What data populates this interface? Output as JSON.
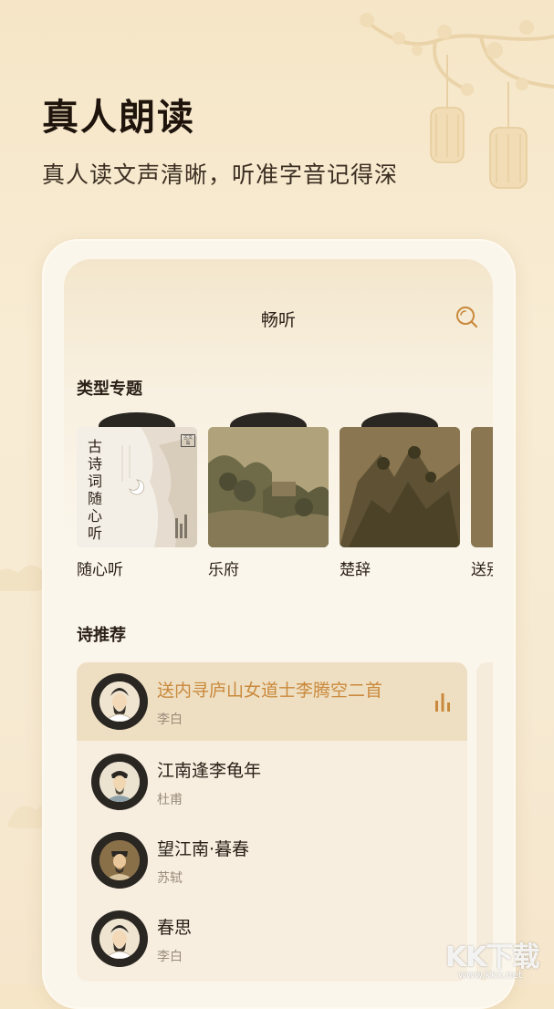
{
  "promo": {
    "headline": "真人朗读",
    "subline": "真人读文声清晰，听准字音记得深"
  },
  "app": {
    "title": "畅听",
    "search_icon": "search-icon"
  },
  "topics": {
    "title": "类型专题",
    "items": [
      {
        "label": "随心听",
        "cover_text": "古诗词随心听",
        "cover_badge": "古文岛"
      },
      {
        "label": "乐府"
      },
      {
        "label": "楚辞"
      },
      {
        "label": "送别"
      }
    ]
  },
  "recommend": {
    "title": "诗推荐",
    "items": [
      {
        "title": "送内寻庐山女道士李腾空二首",
        "author": "李白",
        "playing": true
      },
      {
        "title": "江南逢李龟年",
        "author": "杜甫",
        "playing": false
      },
      {
        "title": "望江南·暮春",
        "author": "苏轼",
        "playing": false
      },
      {
        "title": "春思",
        "author": "李白",
        "playing": false
      }
    ]
  },
  "watermark": {
    "text": "KK下载",
    "url_text": "www.kkx.net"
  },
  "colors": {
    "accent": "#c9893c",
    "text": "#2b2118",
    "muted": "#9a8c7c",
    "active_row": "#efdfc2"
  }
}
